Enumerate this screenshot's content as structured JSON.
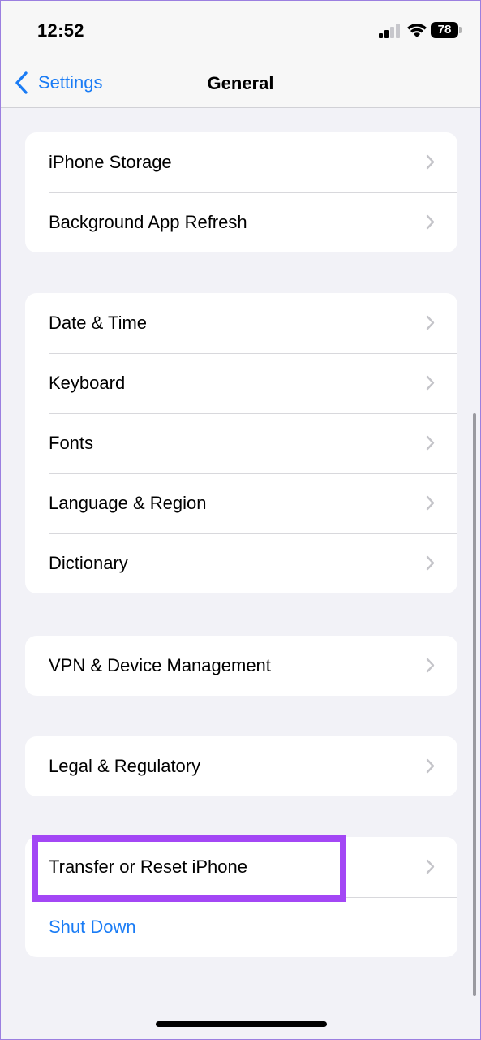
{
  "status": {
    "time": "12:52",
    "battery": "78"
  },
  "nav": {
    "back_label": "Settings",
    "title": "General"
  },
  "groups": [
    {
      "items": [
        {
          "label": "iPhone Storage"
        },
        {
          "label": "Background App Refresh"
        }
      ]
    },
    {
      "items": [
        {
          "label": "Date & Time"
        },
        {
          "label": "Keyboard"
        },
        {
          "label": "Fonts"
        },
        {
          "label": "Language & Region"
        },
        {
          "label": "Dictionary"
        }
      ]
    },
    {
      "items": [
        {
          "label": "VPN & Device Management"
        }
      ]
    },
    {
      "items": [
        {
          "label": "Legal & Regulatory"
        }
      ]
    },
    {
      "items": [
        {
          "label": "Transfer or Reset iPhone"
        },
        {
          "label": "Shut Down"
        }
      ]
    }
  ],
  "colors": {
    "accent": "#1a7cf5",
    "highlight": "#a347f5",
    "background": "#f2f2f7"
  }
}
